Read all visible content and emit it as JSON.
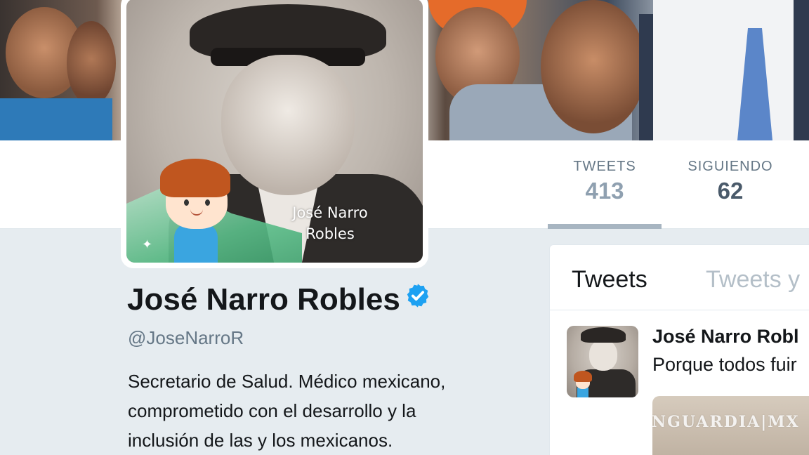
{
  "banner": {},
  "nav": {
    "tweets_label": "TWEETS",
    "tweets_count": "413",
    "following_label": "SIGUIENDO",
    "following_count": "62"
  },
  "avatar": {
    "caption_line1": "José Narro",
    "caption_line2": "Robles"
  },
  "profile": {
    "name": "José Narro Robles",
    "verified_icon": "verified-badge-icon",
    "handle": "@JoseNarroR",
    "bio_line1": "Secretario de Salud. Médico mexicano,",
    "bio_line2": "comprometido con el desarrollo y la",
    "bio_line3": "inclusión de las y los mexicanos."
  },
  "timeline": {
    "tab_tweets": "Tweets",
    "tab_replies": "Tweets y",
    "tweet": {
      "author": "José Narro Robl",
      "text": "Porque todos fuir"
    }
  },
  "watermark": "NGUARDIA|MX",
  "colors": {
    "verified": "#1da1f2",
    "muted": "#657786",
    "background": "#e6ecf0"
  }
}
